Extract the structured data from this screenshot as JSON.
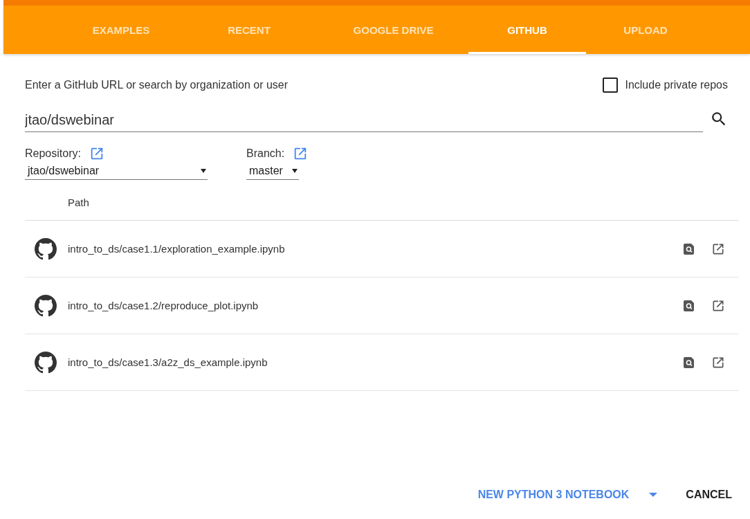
{
  "tabs": [
    {
      "label": "EXAMPLES",
      "selected": false
    },
    {
      "label": "RECENT",
      "selected": false
    },
    {
      "label": "GOOGLE DRIVE",
      "selected": false
    },
    {
      "label": "GITHUB",
      "selected": true
    },
    {
      "label": "UPLOAD",
      "selected": false
    }
  ],
  "search": {
    "label": "Enter a GitHub URL or search by organization or user",
    "value": "jtao/dswebinar"
  },
  "private_repos": {
    "label": "Include private repos",
    "checked": false
  },
  "repository": {
    "label": "Repository:",
    "value": "jtao/dswebinar"
  },
  "branch": {
    "label": "Branch:",
    "value": "master"
  },
  "table": {
    "columns": [
      "Path"
    ],
    "rows": [
      {
        "path": "intro_to_ds/case1.1/exploration_example.ipynb"
      },
      {
        "path": "intro_to_ds/case1.2/reproduce_plot.ipynb"
      },
      {
        "path": "intro_to_ds/case1.3/a2z_ds_example.ipynb"
      }
    ]
  },
  "buttons": {
    "new_notebook": "NEW PYTHON 3 NOTEBOOK",
    "cancel": "CANCEL"
  }
}
